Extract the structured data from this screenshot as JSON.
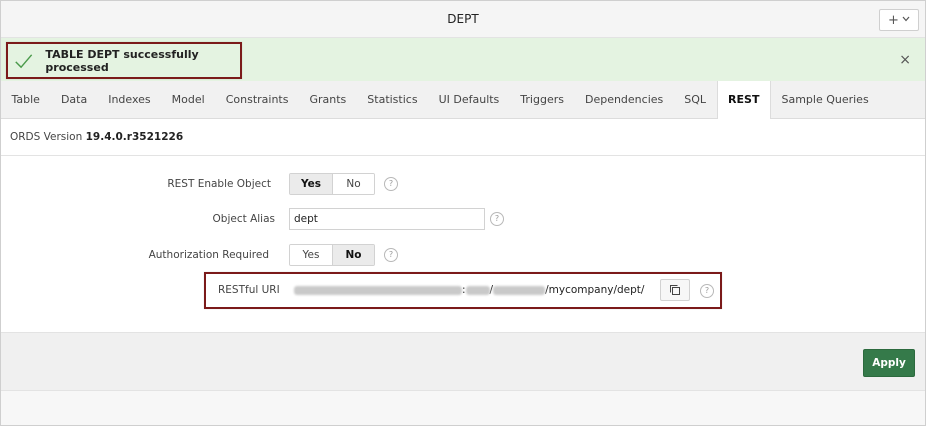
{
  "header": {
    "title": "DEPT",
    "add_label": "+"
  },
  "banner": {
    "message": "TABLE DEPT successfully processed",
    "close_label": "×"
  },
  "tabs": [
    {
      "label": "Table"
    },
    {
      "label": "Data"
    },
    {
      "label": "Indexes"
    },
    {
      "label": "Model"
    },
    {
      "label": "Constraints"
    },
    {
      "label": "Grants"
    },
    {
      "label": "Statistics"
    },
    {
      "label": "UI Defaults"
    },
    {
      "label": "Triggers"
    },
    {
      "label": "Dependencies"
    },
    {
      "label": "SQL"
    },
    {
      "label": "REST",
      "active": true
    },
    {
      "label": "Sample Queries"
    }
  ],
  "ords": {
    "label": "ORDS Version",
    "version": "19.4.0.r3521226"
  },
  "form": {
    "rest_enable": {
      "label": "REST Enable Object",
      "yes": "Yes",
      "no": "No",
      "selected": "Yes"
    },
    "alias": {
      "label": "Object Alias",
      "value": "dept"
    },
    "auth": {
      "label": "Authorization Required",
      "yes": "Yes",
      "no": "No",
      "selected": "No"
    },
    "uri": {
      "label": "RESTful URI",
      "sep1": ":",
      "sep2": "/",
      "suffix": "/mycompany/dept/"
    },
    "help_glyph": "?"
  },
  "footer": {
    "apply_label": "Apply"
  },
  "colors": {
    "banner_bg": "#e4f3e1",
    "accent_border": "#7b1a1a",
    "apply_bg": "#357a4a",
    "check": "#4a9a4a"
  }
}
